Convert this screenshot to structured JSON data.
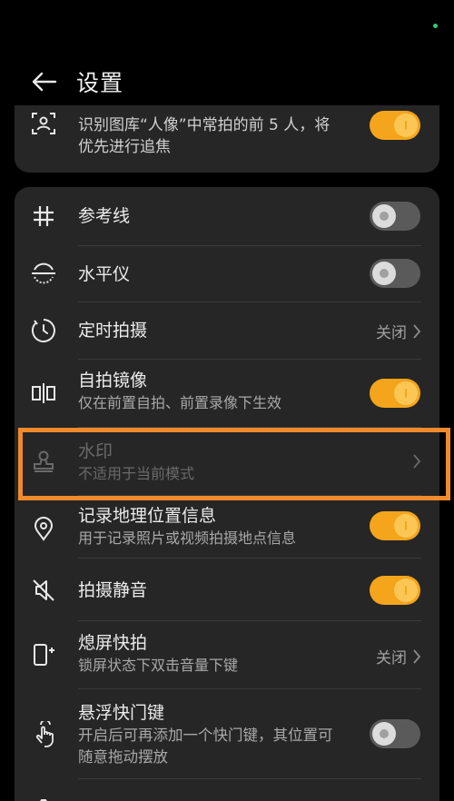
{
  "header": {
    "title": "设置"
  },
  "top_card": {
    "portrait_focus": {
      "label": "识别图库“人像”中常拍的前 5 人，将优先进行追焦",
      "icon": "portrait-scan-icon",
      "enabled": true
    }
  },
  "settings": {
    "grid": {
      "title": "参考线",
      "icon": "grid-icon",
      "enabled": false
    },
    "level": {
      "title": "水平仪",
      "icon": "level-icon",
      "enabled": false
    },
    "timer": {
      "title": "定时拍摄",
      "icon": "timer-icon",
      "value": "关闭"
    },
    "mirror": {
      "title": "自拍镜像",
      "sub": "仅在前置自拍、前置录像下生效",
      "icon": "mirror-icon",
      "enabled": true
    },
    "watermark": {
      "title": "水印",
      "sub": "不适用于当前模式",
      "icon": "stamp-icon",
      "disabled": true
    },
    "location": {
      "title": "记录地理位置信息",
      "sub": "用于记录照片或视频拍摄地点信息",
      "icon": "location-icon",
      "enabled": true
    },
    "mute": {
      "title": "拍摄静音",
      "icon": "mute-icon",
      "enabled": true
    },
    "snapshot": {
      "title": "熄屏快拍",
      "sub": "锁屏状态下双击音量下键",
      "icon": "snapshot-icon",
      "value": "关闭"
    },
    "floating_shutter": {
      "title": "悬浮快门键",
      "sub": "开启后可再添加一个快门键，其位置可随意拖动摆放",
      "icon": "touch-icon",
      "enabled": false
    }
  },
  "colors": {
    "accent": "#f4a51c",
    "highlight": "#f08a2c",
    "card": "#262626",
    "background": "#000000"
  }
}
